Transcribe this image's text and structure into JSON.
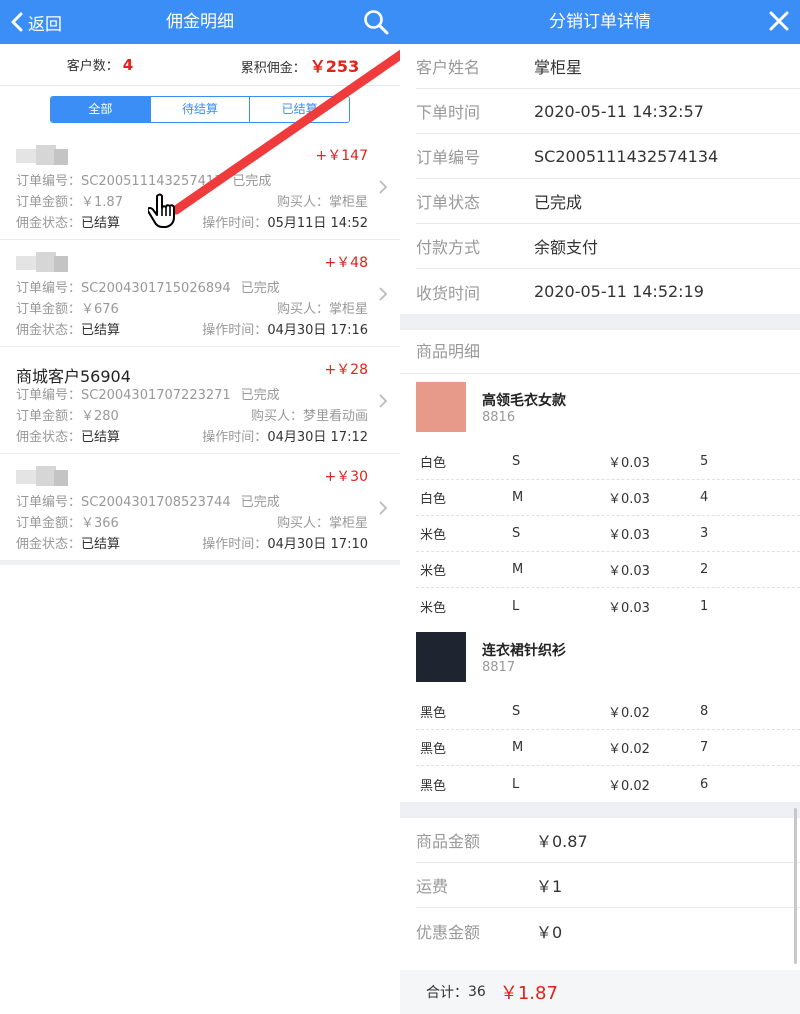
{
  "left": {
    "header": {
      "back_label": "返回",
      "title": "佣金明细"
    },
    "stats": {
      "customer_label": "客户数：",
      "customer_count": "4",
      "commission_label": "累积佣金：",
      "commission_total": "￥253"
    },
    "tabs": [
      {
        "label": "全部",
        "active": true
      },
      {
        "label": "待结算",
        "active": false
      },
      {
        "label": "已结算",
        "active": false
      }
    ],
    "orders": [
      {
        "customer": "",
        "amount": "+￥147",
        "order_label": "订单编号：",
        "order_no": "SC200511143257413",
        "status": "已完成",
        "amount_label": "订单金额：",
        "order_amount": "￥1.87",
        "buyer_label": "购买人：",
        "buyer": "掌柜星",
        "commission_label": "佣金状态：",
        "commission_status": "已结算",
        "time_label": "操作时间：",
        "time": "05月11日 14:52"
      },
      {
        "customer": "",
        "amount": "+￥48",
        "order_label": "订单编号：",
        "order_no": "SC2004301715026894",
        "status": "已完成",
        "amount_label": "订单金额：",
        "order_amount": "￥676",
        "buyer_label": "购买人：",
        "buyer": "掌柜星",
        "commission_label": "佣金状态：",
        "commission_status": "已结算",
        "time_label": "操作时间：",
        "time": "04月30日 17:16"
      },
      {
        "customer": "商城客户56904",
        "amount": "+￥28",
        "order_label": "订单编号：",
        "order_no": "SC2004301707223271",
        "status": "已完成",
        "amount_label": "订单金额：",
        "order_amount": "￥280",
        "buyer_label": "购买人：",
        "buyer": "梦里看动画",
        "commission_label": "佣金状态：",
        "commission_status": "已结算",
        "time_label": "操作时间：",
        "time": "04月30日 17:12"
      },
      {
        "customer": "",
        "amount": "+￥30",
        "order_label": "订单编号：",
        "order_no": "SC2004301708523744",
        "status": "已完成",
        "amount_label": "订单金额：",
        "order_amount": "￥366",
        "buyer_label": "购买人：",
        "buyer": "掌柜星",
        "commission_label": "佣金状态：",
        "commission_status": "已结算",
        "time_label": "操作时间：",
        "time": "04月30日 17:10"
      }
    ]
  },
  "right": {
    "header": {
      "title": "分销订单详情"
    },
    "info": [
      {
        "key": "客户姓名",
        "value": "掌柜星"
      },
      {
        "key": "下单时间",
        "value": "2020-05-11 14:32:57"
      },
      {
        "key": "订单编号",
        "value": "SC2005111432574134"
      },
      {
        "key": "订单状态",
        "value": "已完成"
      },
      {
        "key": "付款方式",
        "value": "余额支付"
      },
      {
        "key": "收货时间",
        "value": "2020-05-11 14:52:19"
      }
    ],
    "goods_title": "商品明细",
    "products": [
      {
        "name": "高领毛衣女款",
        "code": "8816",
        "thumb_color": "#e89a8a",
        "skus": [
          {
            "color": "白色",
            "size": "S",
            "price": "￥0.03",
            "qty": "5"
          },
          {
            "color": "白色",
            "size": "M",
            "price": "￥0.03",
            "qty": "4"
          },
          {
            "color": "米色",
            "size": "S",
            "price": "￥0.03",
            "qty": "3"
          },
          {
            "color": "米色",
            "size": "M",
            "price": "￥0.03",
            "qty": "2"
          },
          {
            "color": "米色",
            "size": "L",
            "price": "￥0.03",
            "qty": "1"
          }
        ]
      },
      {
        "name": "连衣裙针织衫",
        "code": "8817",
        "thumb_color": "#1e2530",
        "skus": [
          {
            "color": "黑色",
            "size": "S",
            "price": "￥0.02",
            "qty": "8"
          },
          {
            "color": "黑色",
            "size": "M",
            "price": "￥0.02",
            "qty": "7"
          },
          {
            "color": "黑色",
            "size": "L",
            "price": "￥0.02",
            "qty": "6"
          }
        ]
      }
    ],
    "summary": [
      {
        "key": "商品金额",
        "value": "￥0.87"
      },
      {
        "key": "运费",
        "value": "￥1"
      },
      {
        "key": "优惠金额",
        "value": "￥0"
      }
    ],
    "footer": {
      "count_label": "合计：",
      "count": "36",
      "total": "￥1.87"
    }
  },
  "colors": {
    "accent": "#3a8ef6",
    "price_red": "#e0221a"
  }
}
